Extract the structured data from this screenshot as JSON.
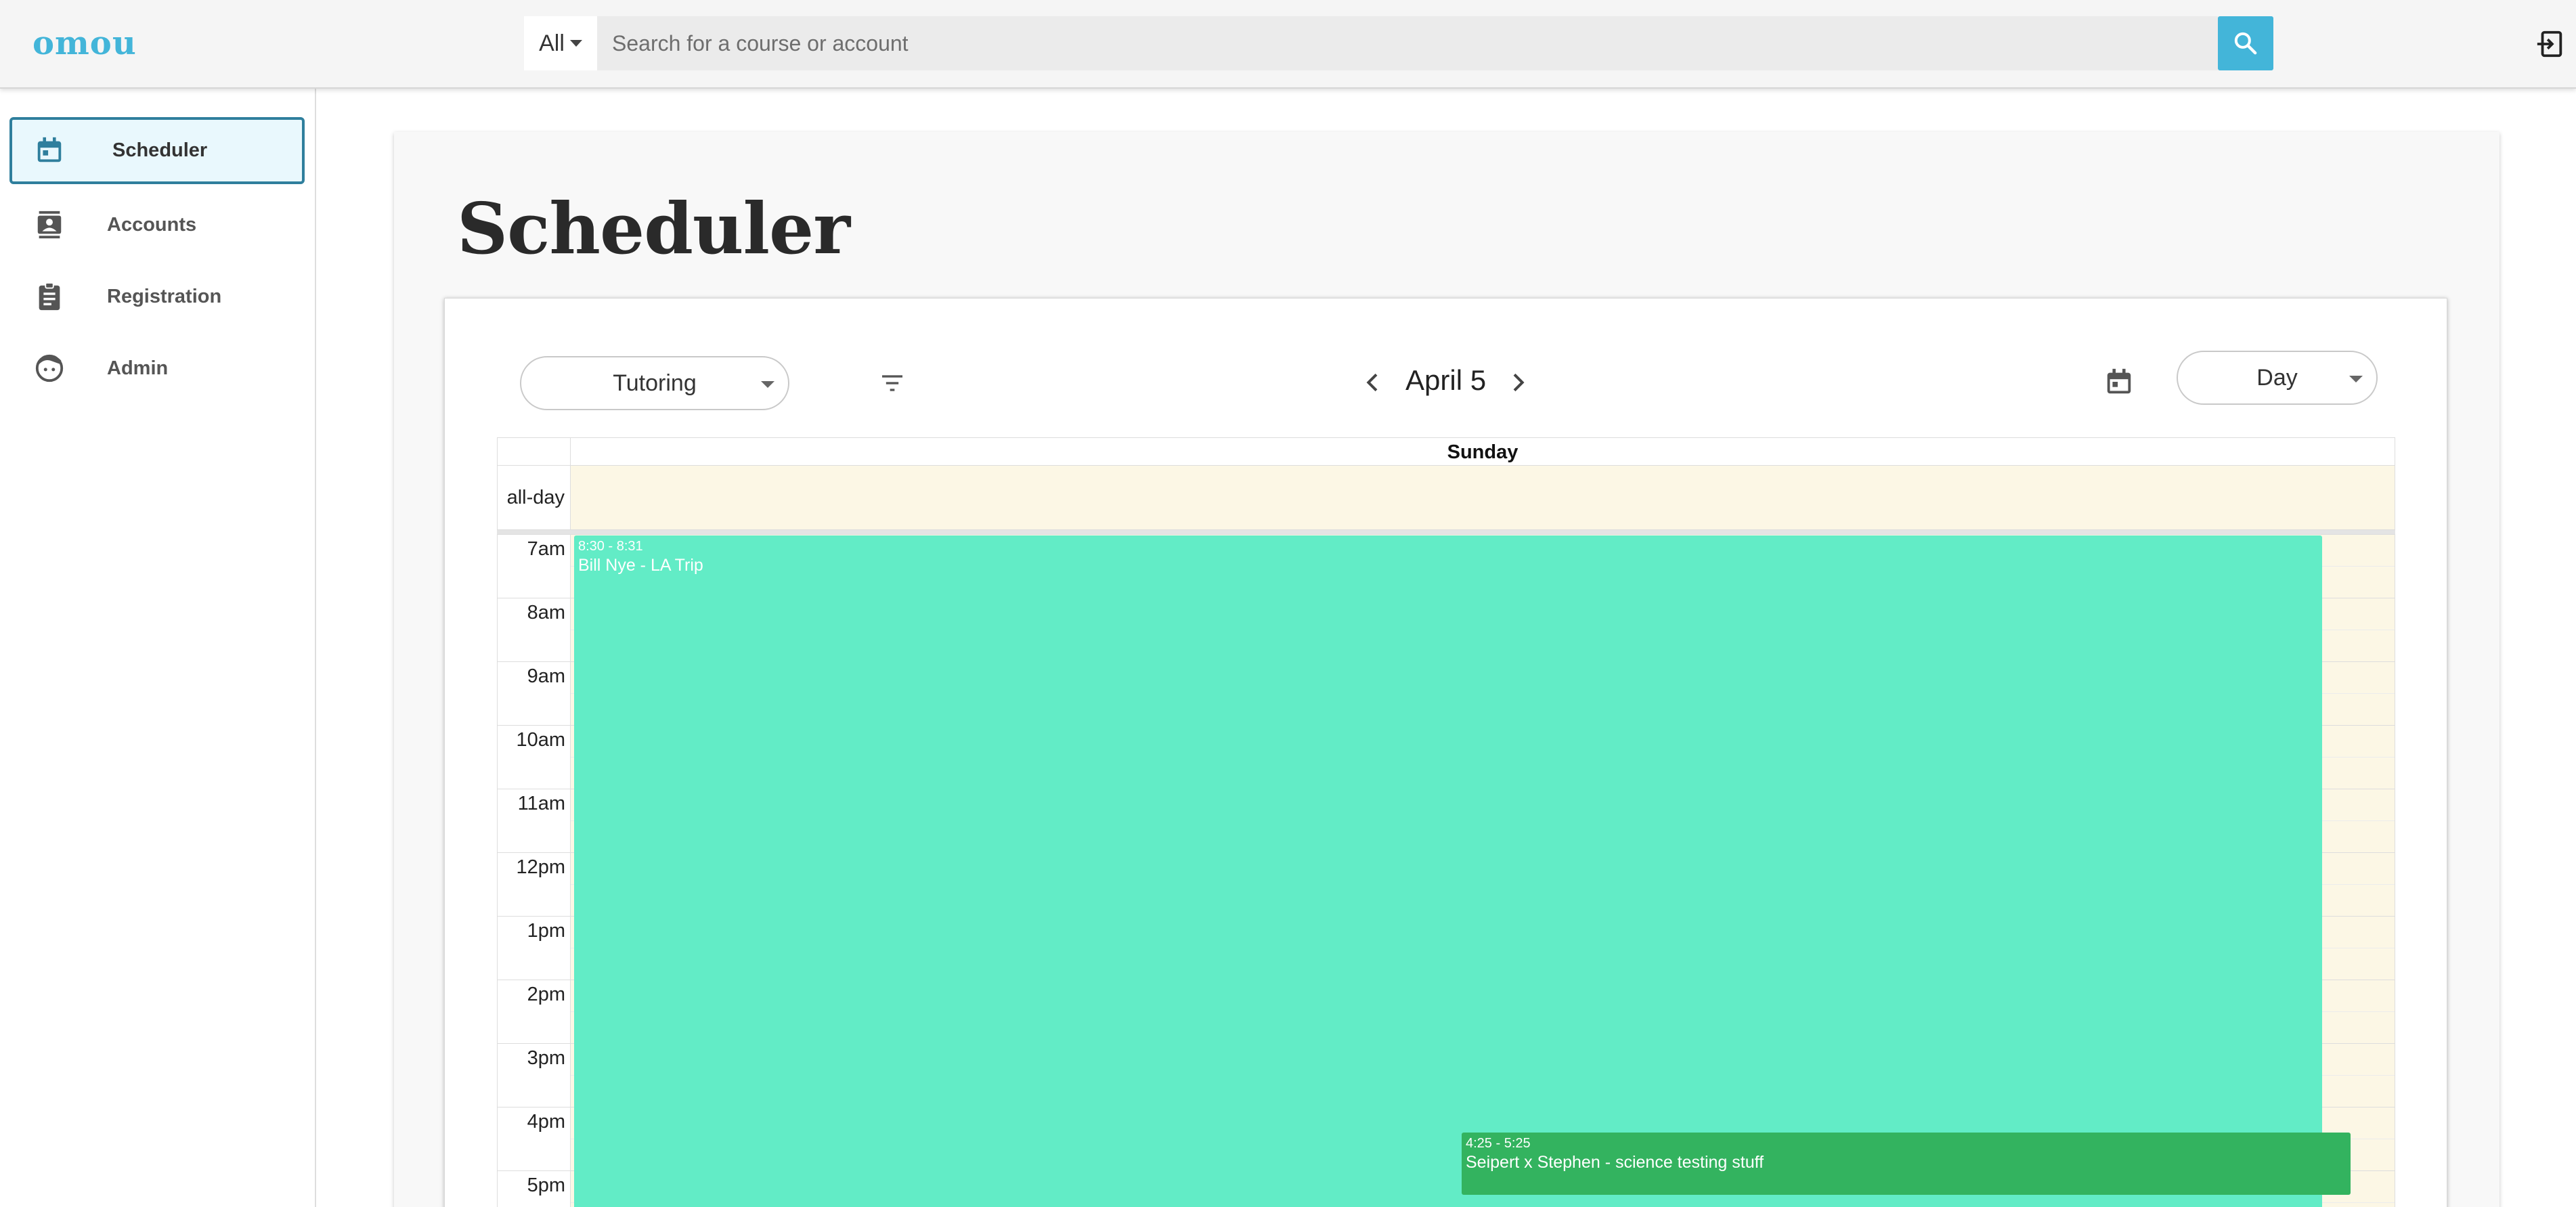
{
  "app": {
    "logo": "omou"
  },
  "search": {
    "scope": "All",
    "placeholder": "Search for a course or account"
  },
  "sidebar": {
    "items": [
      {
        "label": "Scheduler",
        "icon": "calendar-icon",
        "active": true
      },
      {
        "label": "Accounts",
        "icon": "contacts-icon",
        "active": false
      },
      {
        "label": "Registration",
        "icon": "clipboard-icon",
        "active": false
      },
      {
        "label": "Admin",
        "icon": "face-icon",
        "active": false
      }
    ]
  },
  "page": {
    "title": "Scheduler"
  },
  "toolbar": {
    "type_select": "Tutoring",
    "date": "April 5",
    "view_select": "Day"
  },
  "calendar": {
    "day_header": "Sunday",
    "allday_label": "all-day",
    "hours": [
      "7am",
      "8am",
      "9am",
      "10am",
      "11am",
      "12pm",
      "1pm",
      "2pm",
      "3pm",
      "4pm",
      "5pm"
    ],
    "events": [
      {
        "time": "8:30 - 8:31",
        "title": "Bill Nye - LA Trip",
        "color": "#62ecc6"
      },
      {
        "time": "4:25 - 5:25",
        "title": "Seipert x Stephen - science testing stuff",
        "color": "#33b35f"
      }
    ]
  },
  "colors": {
    "accent": "#43b5d9",
    "active_border": "#2f7f9d",
    "today_bg": "#fcf7e5"
  }
}
